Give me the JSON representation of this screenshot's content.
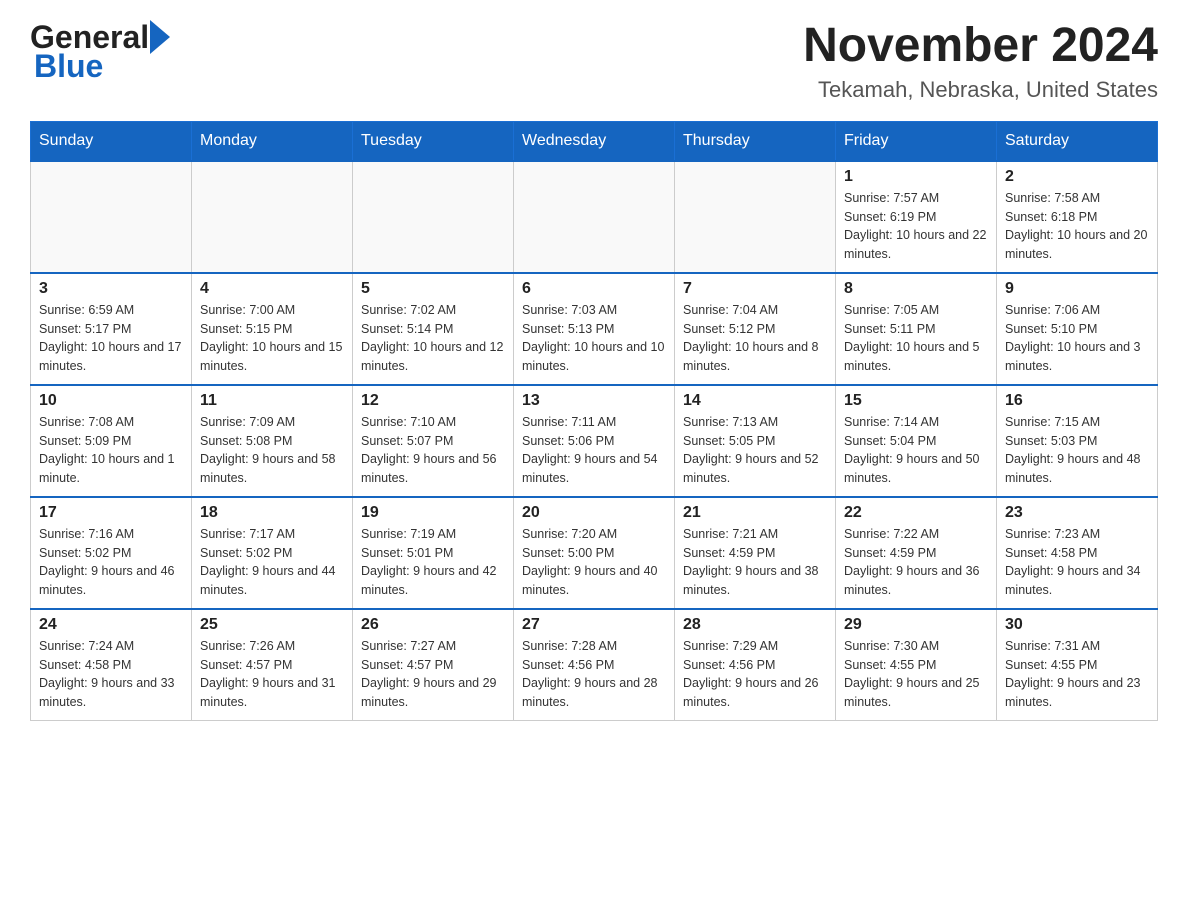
{
  "header": {
    "logo_general": "General",
    "logo_blue": "Blue",
    "main_title": "November 2024",
    "subtitle": "Tekamah, Nebraska, United States"
  },
  "calendar": {
    "weekdays": [
      "Sunday",
      "Monday",
      "Tuesday",
      "Wednesday",
      "Thursday",
      "Friday",
      "Saturday"
    ],
    "weeks": [
      [
        {
          "day": "",
          "info": ""
        },
        {
          "day": "",
          "info": ""
        },
        {
          "day": "",
          "info": ""
        },
        {
          "day": "",
          "info": ""
        },
        {
          "day": "",
          "info": ""
        },
        {
          "day": "1",
          "info": "Sunrise: 7:57 AM\nSunset: 6:19 PM\nDaylight: 10 hours and 22 minutes."
        },
        {
          "day": "2",
          "info": "Sunrise: 7:58 AM\nSunset: 6:18 PM\nDaylight: 10 hours and 20 minutes."
        }
      ],
      [
        {
          "day": "3",
          "info": "Sunrise: 6:59 AM\nSunset: 5:17 PM\nDaylight: 10 hours and 17 minutes."
        },
        {
          "day": "4",
          "info": "Sunrise: 7:00 AM\nSunset: 5:15 PM\nDaylight: 10 hours and 15 minutes."
        },
        {
          "day": "5",
          "info": "Sunrise: 7:02 AM\nSunset: 5:14 PM\nDaylight: 10 hours and 12 minutes."
        },
        {
          "day": "6",
          "info": "Sunrise: 7:03 AM\nSunset: 5:13 PM\nDaylight: 10 hours and 10 minutes."
        },
        {
          "day": "7",
          "info": "Sunrise: 7:04 AM\nSunset: 5:12 PM\nDaylight: 10 hours and 8 minutes."
        },
        {
          "day": "8",
          "info": "Sunrise: 7:05 AM\nSunset: 5:11 PM\nDaylight: 10 hours and 5 minutes."
        },
        {
          "day": "9",
          "info": "Sunrise: 7:06 AM\nSunset: 5:10 PM\nDaylight: 10 hours and 3 minutes."
        }
      ],
      [
        {
          "day": "10",
          "info": "Sunrise: 7:08 AM\nSunset: 5:09 PM\nDaylight: 10 hours and 1 minute."
        },
        {
          "day": "11",
          "info": "Sunrise: 7:09 AM\nSunset: 5:08 PM\nDaylight: 9 hours and 58 minutes."
        },
        {
          "day": "12",
          "info": "Sunrise: 7:10 AM\nSunset: 5:07 PM\nDaylight: 9 hours and 56 minutes."
        },
        {
          "day": "13",
          "info": "Sunrise: 7:11 AM\nSunset: 5:06 PM\nDaylight: 9 hours and 54 minutes."
        },
        {
          "day": "14",
          "info": "Sunrise: 7:13 AM\nSunset: 5:05 PM\nDaylight: 9 hours and 52 minutes."
        },
        {
          "day": "15",
          "info": "Sunrise: 7:14 AM\nSunset: 5:04 PM\nDaylight: 9 hours and 50 minutes."
        },
        {
          "day": "16",
          "info": "Sunrise: 7:15 AM\nSunset: 5:03 PM\nDaylight: 9 hours and 48 minutes."
        }
      ],
      [
        {
          "day": "17",
          "info": "Sunrise: 7:16 AM\nSunset: 5:02 PM\nDaylight: 9 hours and 46 minutes."
        },
        {
          "day": "18",
          "info": "Sunrise: 7:17 AM\nSunset: 5:02 PM\nDaylight: 9 hours and 44 minutes."
        },
        {
          "day": "19",
          "info": "Sunrise: 7:19 AM\nSunset: 5:01 PM\nDaylight: 9 hours and 42 minutes."
        },
        {
          "day": "20",
          "info": "Sunrise: 7:20 AM\nSunset: 5:00 PM\nDaylight: 9 hours and 40 minutes."
        },
        {
          "day": "21",
          "info": "Sunrise: 7:21 AM\nSunset: 4:59 PM\nDaylight: 9 hours and 38 minutes."
        },
        {
          "day": "22",
          "info": "Sunrise: 7:22 AM\nSunset: 4:59 PM\nDaylight: 9 hours and 36 minutes."
        },
        {
          "day": "23",
          "info": "Sunrise: 7:23 AM\nSunset: 4:58 PM\nDaylight: 9 hours and 34 minutes."
        }
      ],
      [
        {
          "day": "24",
          "info": "Sunrise: 7:24 AM\nSunset: 4:58 PM\nDaylight: 9 hours and 33 minutes."
        },
        {
          "day": "25",
          "info": "Sunrise: 7:26 AM\nSunset: 4:57 PM\nDaylight: 9 hours and 31 minutes."
        },
        {
          "day": "26",
          "info": "Sunrise: 7:27 AM\nSunset: 4:57 PM\nDaylight: 9 hours and 29 minutes."
        },
        {
          "day": "27",
          "info": "Sunrise: 7:28 AM\nSunset: 4:56 PM\nDaylight: 9 hours and 28 minutes."
        },
        {
          "day": "28",
          "info": "Sunrise: 7:29 AM\nSunset: 4:56 PM\nDaylight: 9 hours and 26 minutes."
        },
        {
          "day": "29",
          "info": "Sunrise: 7:30 AM\nSunset: 4:55 PM\nDaylight: 9 hours and 25 minutes."
        },
        {
          "day": "30",
          "info": "Sunrise: 7:31 AM\nSunset: 4:55 PM\nDaylight: 9 hours and 23 minutes."
        }
      ]
    ]
  }
}
